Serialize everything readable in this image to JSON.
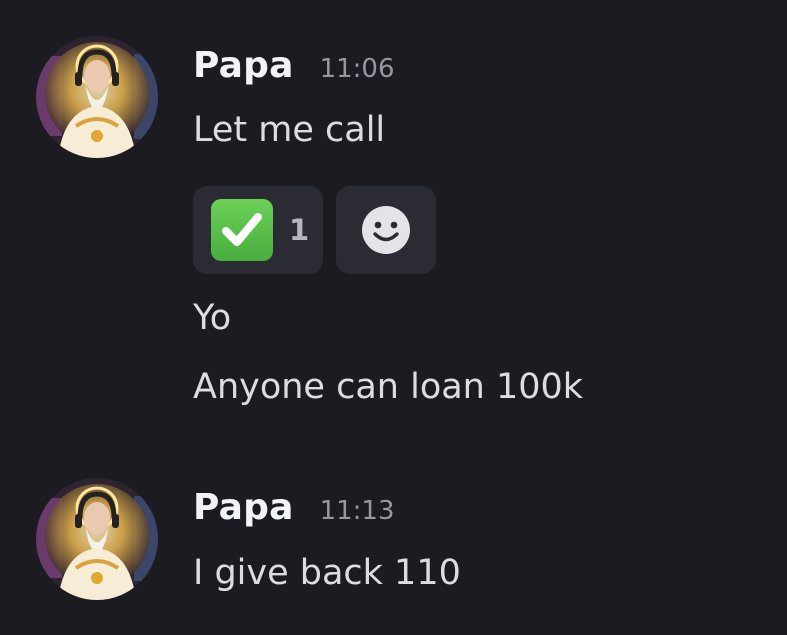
{
  "messages": [
    {
      "username": "Papa",
      "timestamp": "11:06",
      "lines": [
        "Let me call",
        "Yo",
        "Anyone can loan 100k"
      ],
      "reactions": [
        {
          "emoji": "white-check-mark",
          "count": "1"
        }
      ],
      "add_reaction_icon": "smiley-face-icon"
    },
    {
      "username": "Papa",
      "timestamp": "11:13",
      "lines": [
        "I give back 110"
      ]
    }
  ],
  "colors": {
    "background": "#1b1b21",
    "username": "#f2f3f5",
    "timestamp": "#9597a1",
    "message_text": "#dcdde2",
    "reaction_bg": "#2b2c33",
    "check_green": "#5bc24a"
  }
}
